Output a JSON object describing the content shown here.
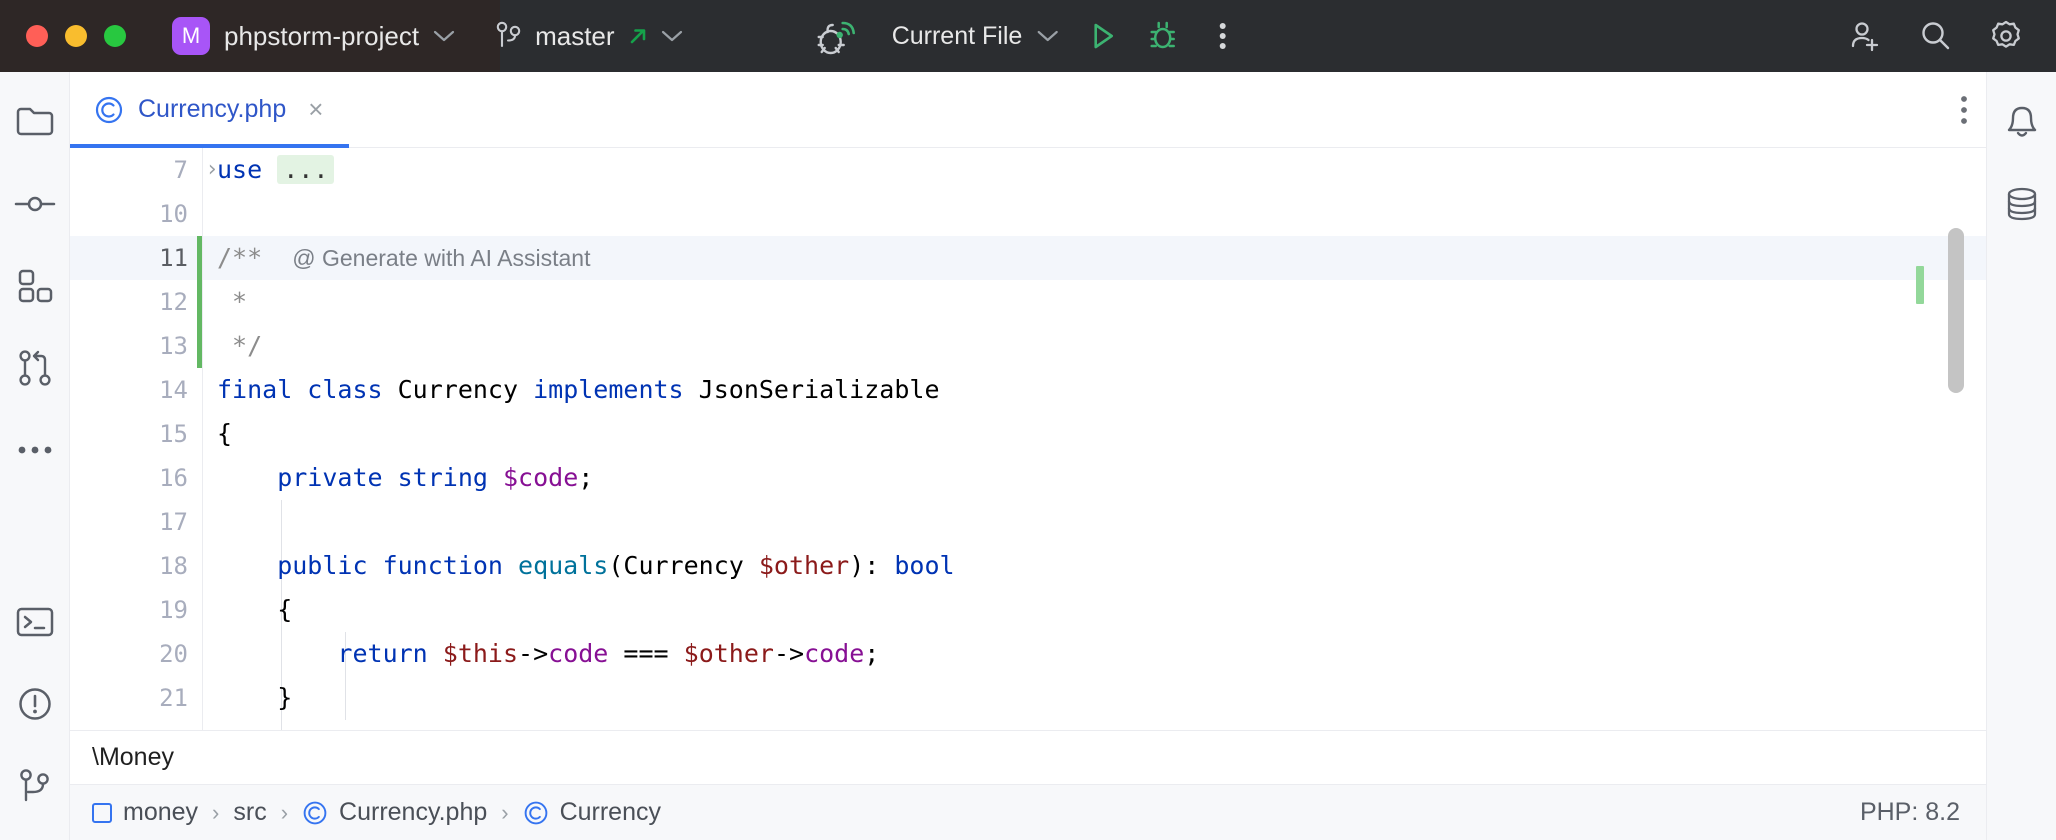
{
  "titlebar": {
    "project_badge": "M",
    "project_name": "phpstorm-project",
    "project_chevron": "∨",
    "branch_name": "master",
    "branch_chevron": "∨",
    "branch_push_arrow": "↗",
    "debug_listener_icon": "bug-listener-icon",
    "run_config_label": "Current File",
    "run_config_chevron": "∨",
    "run_icon": "run-play-icon",
    "debug_icon": "debug-bug-icon",
    "more_icon": "more-vertical-icon",
    "add_user_icon": "add-user-icon",
    "search_icon": "search-icon",
    "settings_icon": "settings-gear-icon"
  },
  "left_stripe": {
    "items": [
      {
        "name": "project-tool-window",
        "icon": "folder-icon"
      },
      {
        "name": "commit-tool-window",
        "icon": "commit-icon"
      },
      {
        "name": "structure-tool-window",
        "icon": "blocks-icon"
      },
      {
        "name": "pull-requests-tool-window",
        "icon": "pull-request-icon"
      },
      {
        "name": "more-tool-windows",
        "icon": "more-horizontal-icon"
      }
    ],
    "bottom_items": [
      {
        "name": "terminal-tool-window",
        "icon": "terminal-icon"
      },
      {
        "name": "problems-tool-window",
        "icon": "warning-circle-icon"
      },
      {
        "name": "version-control-tool-window",
        "icon": "branch-icon"
      }
    ]
  },
  "right_stripe": {
    "items": [
      {
        "name": "notifications-tool-window",
        "icon": "bell-icon"
      },
      {
        "name": "database-tool-window",
        "icon": "database-icon"
      }
    ]
  },
  "tabs": {
    "items": [
      {
        "label": "Currency.php",
        "icon": "php-class-icon",
        "close": "×",
        "active": true
      }
    ],
    "options_icon": "more-vertical-icon"
  },
  "editor": {
    "lines": [
      {
        "num": "7",
        "fold": "›",
        "changed": false,
        "highlight": false,
        "tokens": [
          {
            "t": "use ",
            "c": "kw"
          },
          {
            "t": "...",
            "c": "fold-ph"
          }
        ]
      },
      {
        "num": "10",
        "fold": "",
        "changed": false,
        "highlight": false,
        "tokens": []
      },
      {
        "num": "11",
        "fold": "",
        "changed": true,
        "highlight": true,
        "tokens": [
          {
            "t": "/**",
            "c": "cmt"
          },
          {
            "t": "  ",
            "c": "op"
          },
          {
            "t": "@ Generate with AI Assistant",
            "c": "ai-hint"
          }
        ]
      },
      {
        "num": "12",
        "fold": "",
        "changed": true,
        "highlight": false,
        "tokens": [
          {
            "t": " *",
            "c": "cmt"
          }
        ]
      },
      {
        "num": "13",
        "fold": "",
        "changed": true,
        "highlight": false,
        "tokens": [
          {
            "t": " */",
            "c": "cmt"
          }
        ]
      },
      {
        "num": "14",
        "fold": "",
        "changed": false,
        "highlight": false,
        "tokens": [
          {
            "t": "final class ",
            "c": "kw"
          },
          {
            "t": "Currency ",
            "c": "cls"
          },
          {
            "t": "implements ",
            "c": "kw"
          },
          {
            "t": "JsonSerializable",
            "c": "cls"
          }
        ]
      },
      {
        "num": "15",
        "fold": "",
        "changed": false,
        "highlight": false,
        "tokens": [
          {
            "t": "{",
            "c": "op"
          }
        ]
      },
      {
        "num": "16",
        "fold": "",
        "changed": false,
        "highlight": false,
        "tokens": [
          {
            "t": "    private string ",
            "c": "kw"
          },
          {
            "t": "$code",
            "c": "var"
          },
          {
            "t": ";",
            "c": "op"
          }
        ]
      },
      {
        "num": "17",
        "fold": "",
        "changed": false,
        "highlight": false,
        "tokens": []
      },
      {
        "num": "18",
        "fold": "",
        "changed": false,
        "highlight": false,
        "tokens": [
          {
            "t": "    public function ",
            "c": "kw"
          },
          {
            "t": "equals",
            "c": "fn"
          },
          {
            "t": "(",
            "c": "op"
          },
          {
            "t": "Currency ",
            "c": "cls"
          },
          {
            "t": "$other",
            "c": "varred"
          },
          {
            "t": ")",
            "c": "op"
          },
          {
            "t": ": ",
            "c": "op"
          },
          {
            "t": "bool",
            "c": "kw"
          }
        ]
      },
      {
        "num": "19",
        "fold": "",
        "changed": false,
        "highlight": false,
        "tokens": [
          {
            "t": "    {",
            "c": "op"
          }
        ]
      },
      {
        "num": "20",
        "fold": "",
        "changed": false,
        "highlight": false,
        "tokens": [
          {
            "t": "        return ",
            "c": "kw"
          },
          {
            "t": "$this",
            "c": "varred"
          },
          {
            "t": "->",
            "c": "op"
          },
          {
            "t": "code",
            "c": "var"
          },
          {
            "t": " === ",
            "c": "op"
          },
          {
            "t": "$other",
            "c": "varred"
          },
          {
            "t": "->",
            "c": "op"
          },
          {
            "t": "code",
            "c": "var"
          },
          {
            "t": ";",
            "c": "op"
          }
        ]
      },
      {
        "num": "21",
        "fold": "",
        "changed": false,
        "highlight": false,
        "tokens": [
          {
            "t": "    }",
            "c": "op"
          }
        ]
      }
    ],
    "scrollbar": "vertical-scrollbar",
    "change_marker": "change-stripe-marker"
  },
  "findbar": {
    "value": "\\Money"
  },
  "statusbar": {
    "breadcrumbs": [
      {
        "label": "money",
        "icon": "module-icon"
      },
      {
        "label": "src",
        "icon": ""
      },
      {
        "label": "Currency.php",
        "icon": "php-class-icon"
      },
      {
        "label": "Currency",
        "icon": "php-class-icon"
      }
    ],
    "separator": "›",
    "php_version": "PHP: 8.2"
  },
  "colors": {
    "titlebar_bg": "#2b2d30",
    "titlebar_project_bg": "#2e2726",
    "accent_blue": "#3574f0",
    "tab_text": "#2f56c8",
    "keyword": "#0033b3",
    "variable": "#871094",
    "variable_red": "#8b1a1a",
    "function": "#00729b",
    "comment": "#8c8c8c",
    "change_green": "#63b863",
    "badge_purple": "#a855f7",
    "run_green": "#3cb371"
  }
}
